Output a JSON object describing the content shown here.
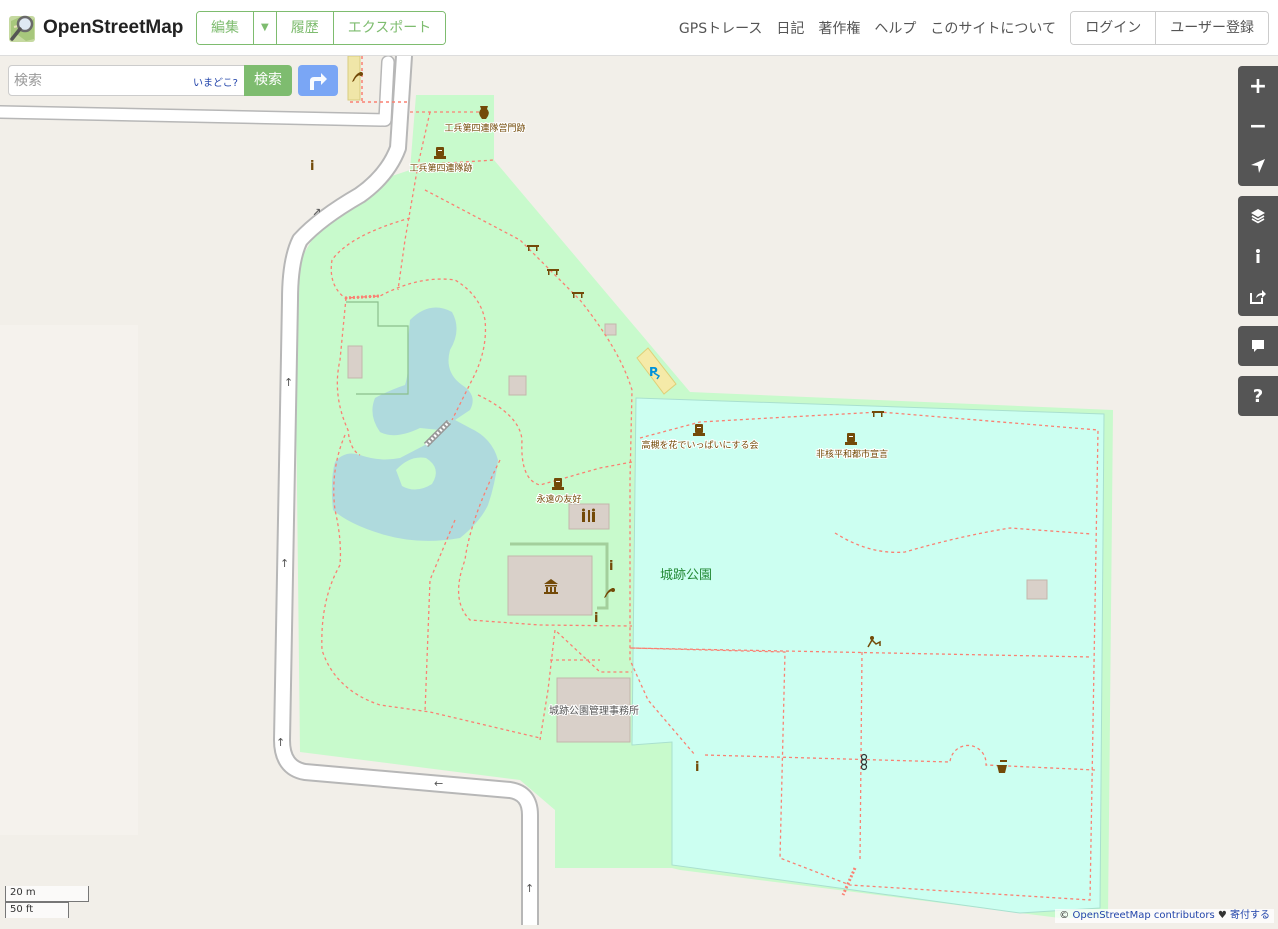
{
  "header": {
    "logo_text": "OpenStreetMap",
    "edit_label": "編集",
    "history_label": "履歴",
    "export_label": "エクスポート",
    "nav": [
      "GPSトレース",
      "日記",
      "著作権",
      "ヘルプ",
      "このサイトについて"
    ],
    "login_label": "ログイン",
    "signup_label": "ユーザー登録"
  },
  "search": {
    "placeholder": "検索",
    "where_am_i": "いまどこ?",
    "button_label": "検索"
  },
  "map_labels": {
    "gate_site": "工兵第四連隊営門跡",
    "regiment_site": "工兵第四連隊跡",
    "flower_society": "高槻を花でいっぱいにする会",
    "peace_declaration": "非核平和都市宣言",
    "eternal_friendship": "永遠の友好",
    "park_name": "城跡公園",
    "park_office": "城跡公園管理事務所"
  },
  "map_icons": [
    "vase-icon",
    "memorial-icon",
    "bench-icon",
    "parking-icon",
    "toilets-icon",
    "museum-icon",
    "information-icon",
    "phone-icon",
    "playground-icon",
    "drinking-water-icon",
    "oneway-arrow-icon"
  ],
  "controls": {
    "zoom_in": "+",
    "zoom_out": "−",
    "help": "?"
  },
  "scale": {
    "metric": "20 m",
    "imperial": "50 ft"
  },
  "attribution": {
    "prefix": "© ",
    "osm_link": "OpenStreetMap contributors",
    "heart": " ♥ ",
    "donate": "寄付する"
  },
  "colors": {
    "brand_green": "#7ebc6f",
    "park_green": "#c8facc",
    "pitch_cyan": "#ccfff1",
    "water": "#aad3df",
    "footway": "#fa8072",
    "building": "#d9d0c9",
    "control_bg": "#555555"
  }
}
